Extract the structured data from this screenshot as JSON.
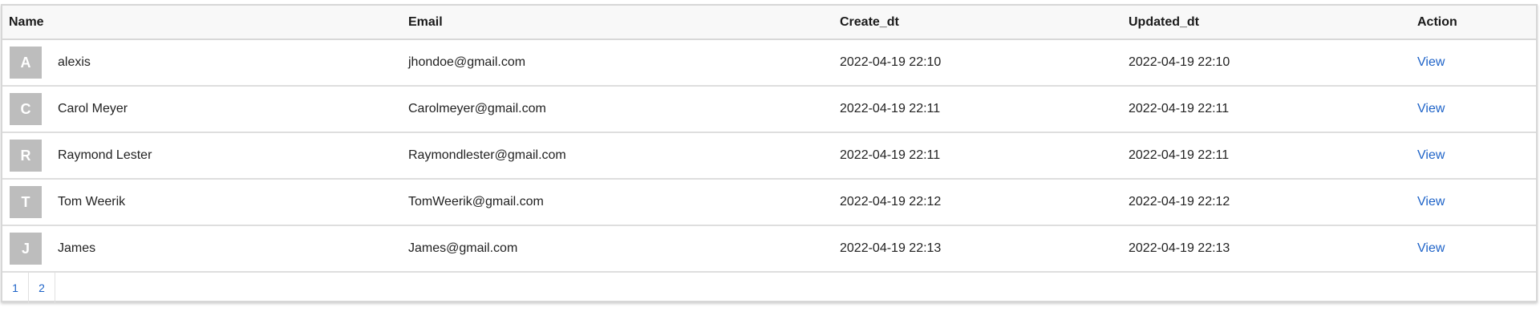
{
  "table": {
    "headers": {
      "name": "Name",
      "email": "Email",
      "created": "Create_dt",
      "updated": "Updated_dt",
      "action": "Action"
    },
    "rows": [
      {
        "initial": "A",
        "name": "alexis",
        "email": "jhondoe@gmail.com",
        "created": "2022-04-19 22:10",
        "updated": "2022-04-19 22:10",
        "action": "View"
      },
      {
        "initial": "C",
        "name": "Carol Meyer",
        "email": "Carolmeyer@gmail.com",
        "created": "2022-04-19 22:11",
        "updated": "2022-04-19 22:11",
        "action": "View"
      },
      {
        "initial": "R",
        "name": "Raymond Lester",
        "email": "Raymondlester@gmail.com",
        "created": "2022-04-19 22:11",
        "updated": "2022-04-19 22:11",
        "action": "View"
      },
      {
        "initial": "T",
        "name": "Tom Weerik",
        "email": "TomWeerik@gmail.com",
        "created": "2022-04-19 22:12",
        "updated": "2022-04-19 22:12",
        "action": "View"
      },
      {
        "initial": "J",
        "name": "James",
        "email": "James@gmail.com",
        "created": "2022-04-19 22:13",
        "updated": "2022-04-19 22:13",
        "action": "View"
      }
    ]
  },
  "pagination": {
    "pages": [
      "1",
      "2"
    ]
  },
  "colors": {
    "link": "#1e63c8",
    "avatar_bg": "#bdbdbd",
    "header_bg": "#f8f8f8"
  }
}
